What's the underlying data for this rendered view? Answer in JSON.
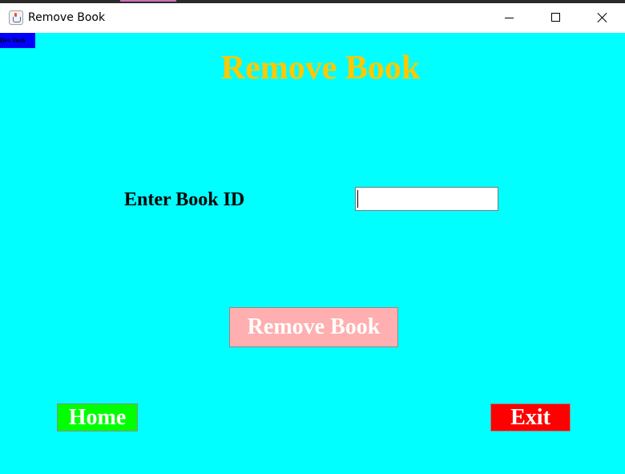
{
  "window": {
    "title": "Remove Book",
    "icon": "java-cup-icon",
    "controls": [
      "minimize-icon",
      "maximize-icon",
      "close-icon"
    ]
  },
  "tag": {
    "text": "Dev Tech"
  },
  "page": {
    "heading": "Remove Book",
    "book_id_label": "Enter Book ID",
    "book_id_value": "",
    "remove_label": "Remove Book",
    "home_label": "Home",
    "exit_label": "Exit"
  },
  "colors": {
    "background": "#00ffff",
    "heading": "#ffc800",
    "remove_button": "#ffafaf",
    "home_button": "#00ff00",
    "exit_button": "#ff0000",
    "tag_background": "#0000ff"
  }
}
